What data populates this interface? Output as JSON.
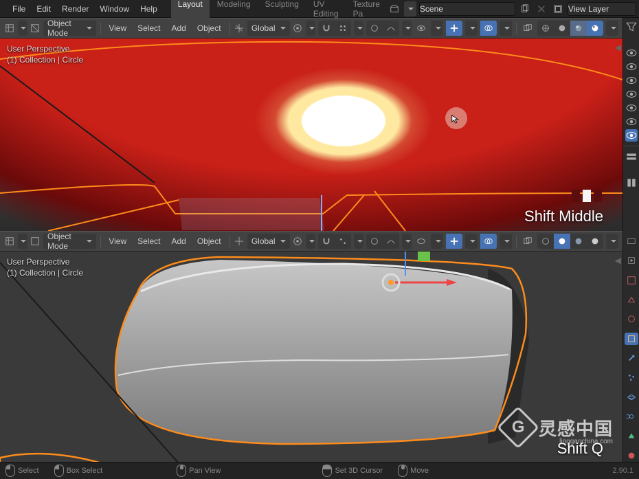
{
  "topmenu": {
    "file": "File",
    "edit": "Edit",
    "render": "Render",
    "window": "Window",
    "help": "Help"
  },
  "workspace": {
    "tabs": [
      "Layout",
      "Modeling",
      "Sculpting",
      "UV Editing",
      "Texture Pa"
    ],
    "active": 0
  },
  "scene_field": {
    "label": "Scene"
  },
  "layer_field": {
    "label": "View Layer"
  },
  "viewport_header": {
    "mode": "Object Mode",
    "view": "View",
    "select": "Select",
    "add": "Add",
    "object": "Object",
    "orientation": "Global"
  },
  "overlay": {
    "perspective": "User Perspective",
    "collection": "(1) Collection | Circle"
  },
  "hint_top": "Shift Middle",
  "hint_bot": "Shift Q",
  "statusbar": {
    "select": "Select",
    "box": "Box Select",
    "pan": "Pan View",
    "cursor3d": "Set 3D Cursor",
    "move": "Move",
    "version": "2.90.1"
  },
  "colors": {
    "orange": "#f57900",
    "blueActive": "#4772b3",
    "outline": "#ff8c1a"
  },
  "watermark": {
    "zh": "灵感中国",
    "url": "lingganchina.com"
  }
}
